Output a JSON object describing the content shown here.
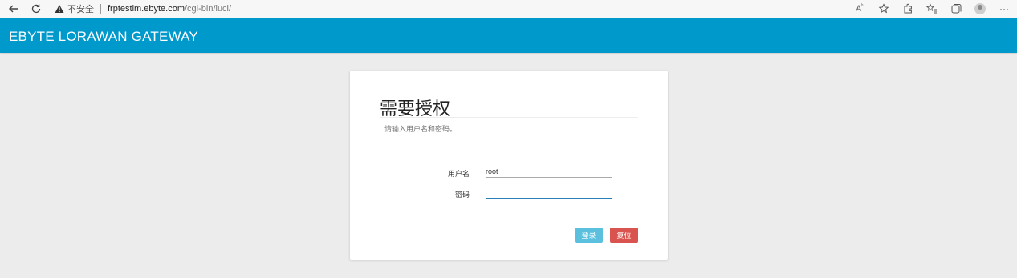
{
  "browser": {
    "insecure_label": "不安全",
    "url_host": "frptestlm.ebyte.com",
    "url_path": "/cgi-bin/luci/"
  },
  "header": {
    "brand": "EBYTE LORAWAN GATEWAY",
    "color": "#0099cc"
  },
  "login": {
    "title": "需要授权",
    "description": "请输入用户名和密码。",
    "username_label": "用户名",
    "username_value": "root",
    "password_label": "密码",
    "password_value": "",
    "login_button": "登录",
    "reset_button": "复位"
  },
  "icons": [
    "back-arrow-icon",
    "refresh-icon",
    "warning-icon",
    "read-aloud-icon",
    "favorite-add-icon",
    "extensions-icon",
    "favorites-icon",
    "collections-icon",
    "profile-avatar",
    "more-icon"
  ]
}
